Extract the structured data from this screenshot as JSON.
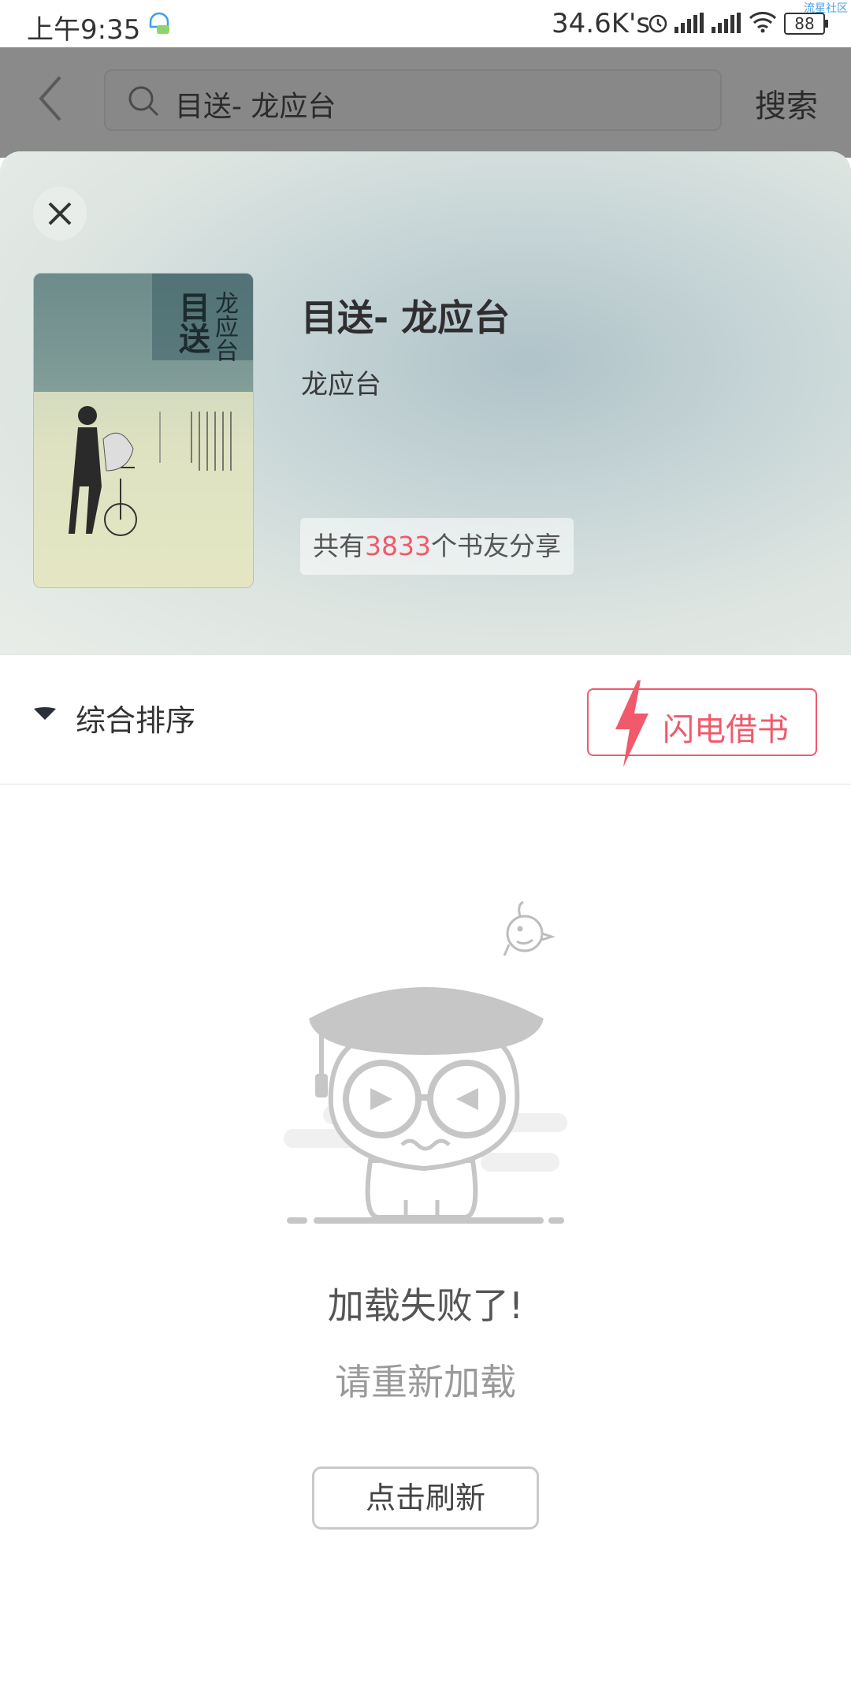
{
  "status_bar": {
    "time": "上午9:35",
    "net_speed": "34.6K's",
    "battery": "88",
    "watermark": "流星社区"
  },
  "search": {
    "query": "目送- 龙应台",
    "button_label": "搜索"
  },
  "book": {
    "title": "目送- 龙应台",
    "author": "龙应台",
    "share_prefix": "共有",
    "share_count": "3833",
    "share_suffix": "个书友分享",
    "cover_title": "目送",
    "cover_author": "龙应台"
  },
  "sort": {
    "label": "综合排序",
    "flash_label": "闪电借书"
  },
  "empty_state": {
    "title": "加载失败了!",
    "subtitle": "请重新加载",
    "refresh_label": "点击刷新"
  },
  "colors": {
    "accent": "#f05a6b",
    "dim_header": "#8a8a8a"
  }
}
